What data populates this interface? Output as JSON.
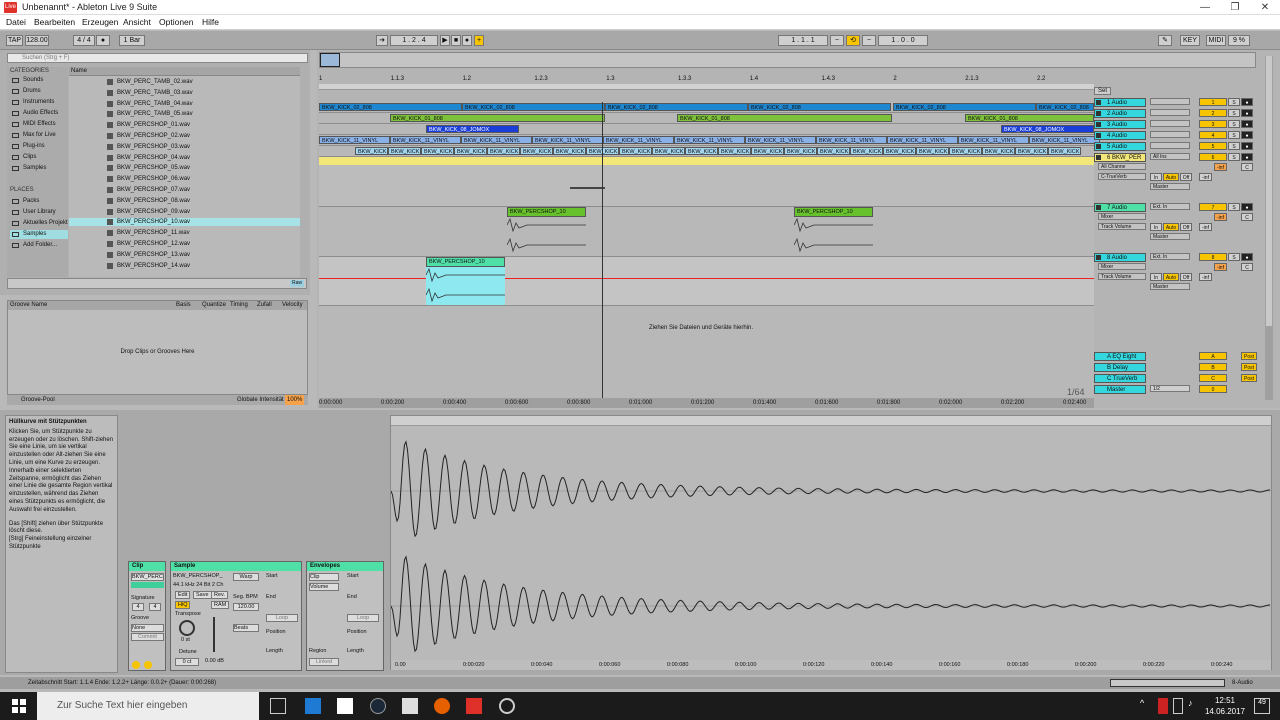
{
  "window": {
    "title": "Unbenannt* - Ableton Live 9 Suite",
    "icon_label": "Live"
  },
  "menu": [
    "Datei",
    "Bearbeiten",
    "Erzeugen",
    "Ansicht",
    "Optionen",
    "Hilfe"
  ],
  "transport": {
    "tap": "TAP",
    "tempo": "128.00",
    "sig": "4 / 4",
    "quant": "1 Bar",
    "pos": "1 . 2 . 4",
    "loop_start": "1 . 1 . 1",
    "loop_len": "1 . 0 . 0",
    "key": "KEY",
    "midi": "MIDI",
    "cpu": "9 %",
    "ruler_labels": [
      "1",
      "1.1.3",
      "1.2",
      "1.2.3",
      "1.3",
      "1.3.3",
      "1.4",
      "1.4.3",
      "2",
      "2.1.3",
      "2.2"
    ]
  },
  "browser": {
    "search_placeholder": "Suchen (Strg + F)",
    "categories_head": "CATEGORIES",
    "categories": [
      "Sounds",
      "Drums",
      "Instruments",
      "Audio Effects",
      "MIDI Effects",
      "Max for Live",
      "Plug-ins",
      "Clips",
      "Samples"
    ],
    "places_head": "PLACES",
    "places": [
      "Packs",
      "User Library",
      "Aktuelles Projekt",
      "Samples",
      "Add Folder..."
    ],
    "files_head": "Name",
    "files": [
      "BKW_PERC_TAMB_02.wav",
      "BKW_PERC_TAMB_03.wav",
      "BKW_PERC_TAMB_04.wav",
      "BKW_PERC_TAMB_05.wav",
      "BKW_PERCSHOP_01.wav",
      "BKW_PERCSHOP_02.wav",
      "BKW_PERCSHOP_03.wav",
      "BKW_PERCSHOP_04.wav",
      "BKW_PERCSHOP_05.wav",
      "BKW_PERCSHOP_06.wav",
      "BKW_PERCSHOP_07.wav",
      "BKW_PERCSHOP_08.wav",
      "BKW_PERCSHOP_09.wav",
      "BKW_PERCSHOP_10.wav",
      "BKW_PERCSHOP_11.wav",
      "BKW_PERCSHOP_12.wav",
      "BKW_PERCSHOP_13.wav",
      "BKW_PERCSHOP_14.wav"
    ],
    "preview_btn": "Raw"
  },
  "groove": {
    "headers": [
      "Groove Name",
      "Basis",
      "Quantize",
      "Timing",
      "Zufall",
      "Velocity"
    ],
    "drop_text": "Drop Clips or Grooves Here",
    "pool": "Groove-Pool",
    "intensity_label": "Globale Intensität",
    "intensity": "100%"
  },
  "arrangement": {
    "timeline": [
      "0:00:000",
      "0:00:200",
      "0:00:400",
      "0:00:600",
      "0:00:800",
      "0:01:000",
      "0:01:200",
      "0:01:400",
      "0:01:600",
      "0:01:800",
      "0:02:000",
      "0:02:200",
      "0:02:400"
    ],
    "drop_text": "Ziehen Sie Dateien und Geräte hierhin.",
    "zoom": "1/64",
    "clip_kick02": "BKW_KICK_02_808",
    "clip_kick01": "BKW_KICK_01_808",
    "clip_jomox": "BKW_KICK_08_JOMOX",
    "clip_vinyl": "BKW_KICK_11_VINYL",
    "clip_short": "BKW_KICK",
    "clip_perc": "BKW_PERCSHOP_10"
  },
  "mixer": {
    "set_label": "Set",
    "tracks": [
      {
        "name": "1 Audio",
        "num": "1",
        "color": "#35d7df"
      },
      {
        "name": "2 Audio",
        "num": "2",
        "color": "#35d7df"
      },
      {
        "name": "3 Audio",
        "num": "3",
        "color": "#35d7df"
      },
      {
        "name": "4 Audio",
        "num": "4",
        "color": "#35d7df"
      },
      {
        "name": "5 Audio",
        "num": "5",
        "color": "#35d7df"
      },
      {
        "name": "6 BKW_PER",
        "num": "6",
        "color": "#f4e77a"
      },
      {
        "name": "7 Audio",
        "num": "7",
        "color": "#4fe0a8"
      },
      {
        "name": "8 Audio",
        "num": "8",
        "color": "#35d7df"
      }
    ],
    "returns": [
      {
        "name": "A EQ Eight",
        "num": "A"
      },
      {
        "name": "B Delay",
        "num": "B"
      },
      {
        "name": "C TrueVerb",
        "num": "C"
      },
      {
        "name": "Master",
        "num": "0"
      }
    ],
    "labels": {
      "all_ins": "All Ins",
      "all_channels": "All Channe",
      "reverb": "C-TrueVerb",
      "ext_in": "Ext. In",
      "mixer": "Mixer",
      "track_volume": "Track Volume",
      "master": "Master",
      "in": "In",
      "auto": "Auto",
      "off": "Off",
      "inf": "-inf",
      "s": "S",
      "c": "C",
      "post": "Post",
      "master_vol": "1/2"
    }
  },
  "detail": {
    "info_title": "Hüllkurve mit Stützpunkten",
    "info_text": "Klicken Sie, um Stützpunkte zu erzeugen oder zu löschen. Shift-ziehen Sie eine Linie, um sie vertikal einzustellen oder Alt-ziehen Sie eine Linie, um eine Kurve zu erzeugen. Innerhalb einer selektierten Zeitspanne, ermöglicht das Ziehen einer Linie die gesamte Region vertikal einzustellen, während das Ziehen eines Stützpunkts es ermöglicht, die Auswahl frei einzustellen.",
    "info_text2": "Das [Shift] ziehen über Stützpunkte löscht diese.",
    "info_text3": "[Strg] Feineinstellung einzelner Stützpunkte",
    "clip": {
      "title": "Clip",
      "name": "BKW_PERC",
      "signature": "Signature",
      "sig_n": "4",
      "sig_d": "4",
      "groove": "Groove",
      "none": "None",
      "commit": "Commit"
    },
    "sample": {
      "title": "Sample",
      "name": "BKW_PERCSHOP_",
      "info": "44.1 kHz 24 Bit 2 Ch",
      "edit": "Edit",
      "save": "Save",
      "rev": "Rev.",
      "hiq": "HiQ",
      "ram": "RAM",
      "transpose": "Transpose",
      "transpose_val": "0 st",
      "detune": "Detune",
      "detune_val": "0 ct",
      "gain": "0.00 dB",
      "warp": "Warp",
      "seg_bpm": "Seg. BPM",
      "bpm": "120.00",
      "beats": "Beats",
      "start": "Start",
      "end": "End",
      "loop": "Loop",
      "position": "Position",
      "length": "Length"
    },
    "envelopes": {
      "title": "Envelopes",
      "clip": "Clip",
      "volume": "Volume",
      "start": "Start",
      "end": "End",
      "loop": "Loop",
      "position": "Position",
      "region": "Region",
      "length": "Length",
      "linked": "Linked"
    },
    "wave_timeline": [
      "0.00",
      "0:00:020",
      "0:00:040",
      "0:00:060",
      "0:00:080",
      "0:00:100",
      "0:00:120",
      "0:00:140",
      "0:00:160",
      "0:00:180",
      "0:00:200",
      "0:00:220",
      "0:00:240"
    ]
  },
  "status": {
    "text": "Zeitabschnitt    Start: 1.1.4    Ende: 1.2.2+    Länge: 0.0.2+ (Dauer: 0:00:268)",
    "right": "8-Audio"
  },
  "taskbar": {
    "search": "Zur Suche Text hier eingeben",
    "time": "12:51",
    "date": "14.06.2017",
    "notif": "49"
  }
}
